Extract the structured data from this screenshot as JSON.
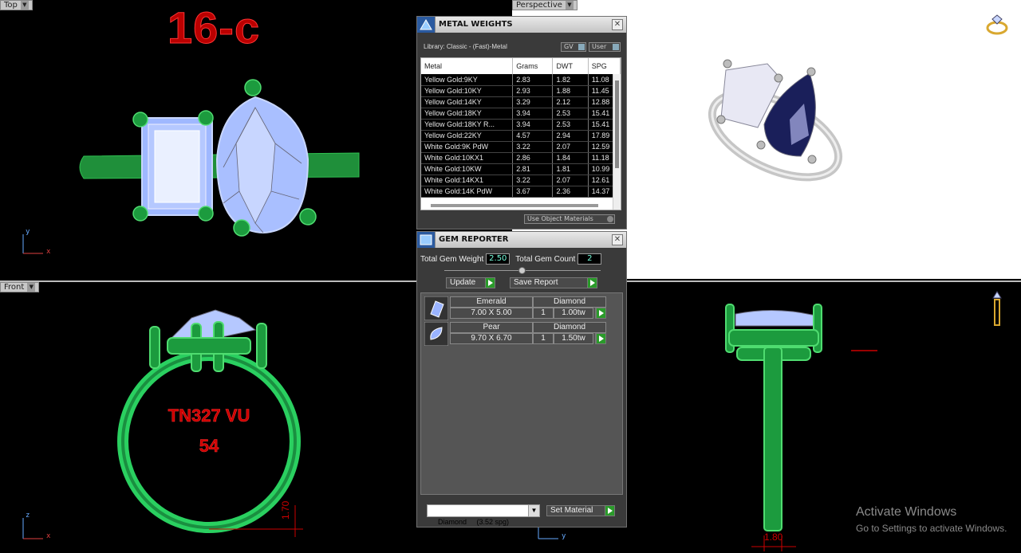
{
  "viewports": {
    "top": {
      "label": "Top",
      "title": "16-c",
      "axis_y": "y",
      "axis_x": "x"
    },
    "front": {
      "label": "Front",
      "engraving_line1": "TN327 VU",
      "engraving_line2": "54",
      "dimension": "1.70",
      "axis_z": "z",
      "axis_x": "x"
    },
    "perspective": {
      "label": "Perspective"
    },
    "right": {
      "dimension": "1.80",
      "axis_y": "y"
    }
  },
  "metal_weights": {
    "title": "METAL WEIGHTS",
    "library": "Library: Classic - (Fast)-Metal",
    "toggle_gv": "GV",
    "toggle_user": "User",
    "columns": [
      "Metal",
      "Grams",
      "DWT",
      "SPG"
    ],
    "rows": [
      [
        "Yellow Gold:9KY",
        "2.83",
        "1.82",
        "11.08"
      ],
      [
        "Yellow Gold:10KY",
        "2.93",
        "1.88",
        "11.45"
      ],
      [
        "Yellow Gold:14KY",
        "3.29",
        "2.12",
        "12.88"
      ],
      [
        "Yellow Gold:18KY",
        "3.94",
        "2.53",
        "15.41"
      ],
      [
        "Yellow Gold:18KY R...",
        "3.94",
        "2.53",
        "15.41"
      ],
      [
        "Yellow Gold:22KY",
        "4.57",
        "2.94",
        "17.89"
      ],
      [
        "White Gold:9K PdW",
        "3.22",
        "2.07",
        "12.59"
      ],
      [
        "White Gold:10KX1",
        "2.86",
        "1.84",
        "11.18"
      ],
      [
        "White Gold:10KW",
        "2.81",
        "1.81",
        "10.99"
      ],
      [
        "White Gold:14KX1",
        "3.22",
        "2.07",
        "12.61"
      ],
      [
        "White Gold:14K PdW",
        "3.67",
        "2.36",
        "14.37"
      ]
    ],
    "use_object_materials": "Use Object Materials"
  },
  "gem_reporter": {
    "title": "GEM REPORTER",
    "total_weight_label": "Total Gem Weight",
    "total_weight": "2.50",
    "total_count_label": "Total Gem Count",
    "total_count": "2",
    "update_label": "Update",
    "save_report_label": "Save Report",
    "gems": [
      {
        "shape": "Emerald",
        "size": "7.00 X 5.00",
        "material": "Diamond",
        "count": "1",
        "weight": "1.00tw"
      },
      {
        "shape": "Pear",
        "size": "9.70 X 6.70",
        "material": "Diamond",
        "count": "1",
        "weight": "1.50tw"
      }
    ],
    "material_select": "Diamond     (3.52 spg)",
    "set_material_label": "Set Material"
  },
  "watermark": {
    "title": "Activate Windows",
    "subtitle": "Go to Settings to activate Windows."
  }
}
